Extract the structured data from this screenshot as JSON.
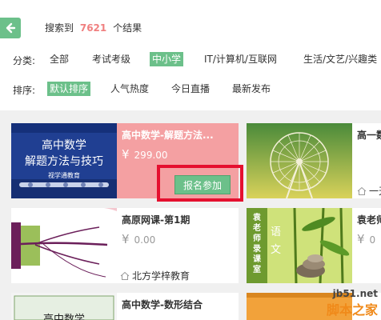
{
  "search": {
    "prefix": "搜索到",
    "count": "7621",
    "suffix": "个结果"
  },
  "filters": {
    "category_label": "分类:",
    "categories": [
      "全部",
      "考试考级",
      "中小学",
      "IT/计算机/互联网",
      "生活/文艺/兴趣类"
    ],
    "active_category": "中小学",
    "sort_label": "排序:",
    "sorts": [
      "默认排序",
      "人气热度",
      "今日直播",
      "最新发布"
    ],
    "active_sort": "默认排序"
  },
  "courses": [
    {
      "title": "高中数学-解题方法...",
      "price_symbol": "¥",
      "price": "299.00",
      "thumb_text": [
        "高中数学",
        "解题方法与技巧"
      ],
      "thumb_brand": "视学通教育",
      "button": "报名参加"
    },
    {
      "title": "高原网课-第1期",
      "price_symbol": "¥",
      "price": "0.00",
      "org": "北方学梓教育"
    },
    {
      "title": "高中数学-数形结合",
      "thumb_text": [
        "高中数学"
      ]
    }
  ],
  "right_cards": [
    {
      "title": "高一数",
      "org": "一天"
    },
    {
      "title": "袁老师",
      "price_symbol": "¥",
      "price": "0",
      "thumb_text": [
        "袁",
        "老",
        "师",
        "录",
        "课",
        "室",
        "语",
        "文"
      ]
    }
  ],
  "watermark": {
    "url": "jb51.net",
    "brand": "脚本之家"
  },
  "colors": {
    "accent": "#6cc08a",
    "price_highlight": "#f07f7f",
    "highlight_card": "#f4a0a2",
    "callout_border": "#e5102f"
  }
}
